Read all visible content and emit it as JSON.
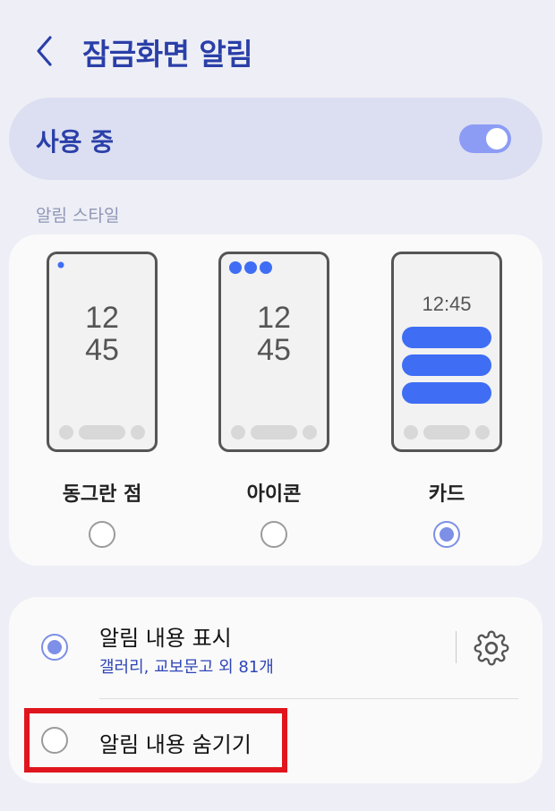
{
  "header": {
    "title": "잠금화면 알림",
    "back_icon": "chevron-left-icon"
  },
  "master": {
    "label": "사용 중",
    "enabled": true
  },
  "style_section": {
    "label": "알림 스타일",
    "clock_hour": "12",
    "clock_minute": "45",
    "card_time": "12:45",
    "options": [
      {
        "name": "동그란 점",
        "selected": false
      },
      {
        "name": "아이콘",
        "selected": false
      },
      {
        "name": "카드",
        "selected": true
      }
    ]
  },
  "content_section": {
    "show": {
      "title": "알림 내용 표시",
      "subtitle": "갤러리, 교보문고 외 81개",
      "selected": true,
      "settings_icon": "gear-icon"
    },
    "hide": {
      "title": "알림 내용 숨기기",
      "selected": false
    }
  },
  "colors": {
    "accent": "#2a3fa8",
    "toggle_on": "#8c9cf5",
    "card_bar": "#3f6ef5",
    "highlight": "#e0151d"
  }
}
